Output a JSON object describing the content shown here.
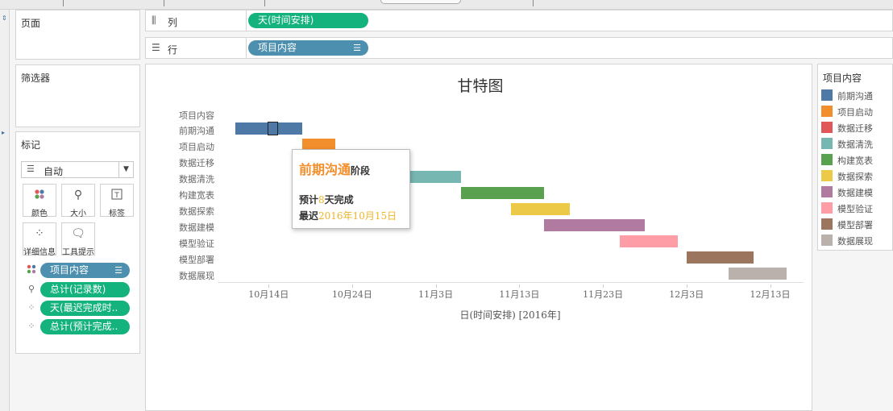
{
  "panels": {
    "pages_title": "页面",
    "filters_title": "筛选器",
    "marks_title": "标记"
  },
  "shelves": {
    "columns": {
      "label": "列",
      "pill": "天(时间安排)"
    },
    "rows": {
      "label": "行",
      "pill": "项目内容"
    }
  },
  "marks": {
    "mark_type": "自动",
    "buttons": [
      "颜色",
      "大小",
      "标签",
      "详细信息",
      "工具提示"
    ],
    "fields": [
      {
        "text": "项目内容",
        "color": "blue",
        "icon": "color-dots-icon"
      },
      {
        "text": "总计(记录数)",
        "color": "green",
        "icon": "size-icon"
      },
      {
        "text": "天(最迟完成时..",
        "color": "green",
        "icon": "detail-icon"
      },
      {
        "text": "总计(预计完成..",
        "color": "green",
        "icon": "detail-icon"
      }
    ]
  },
  "chart_data": {
    "type": "bar",
    "title": "甘特图",
    "ylabel_header": "项目内容",
    "categories": [
      "前期沟通",
      "项目启动",
      "数据迁移",
      "数据清洗",
      "构建宽表",
      "数据探索",
      "数据建模",
      "模型验证",
      "模型部署",
      "数据展现"
    ],
    "start": [
      "2016-10-10",
      "2016-10-18",
      "2016-10-22",
      "2016-10-26",
      "2016-11-06",
      "2016-11-12",
      "2016-11-16",
      "2016-11-25",
      "2016-12-03",
      "2016-12-08"
    ],
    "end": [
      "2016-10-18",
      "2016-10-22",
      "2016-10-26",
      "2016-11-06",
      "2016-11-16",
      "2016-11-19",
      "2016-11-28",
      "2016-12-02",
      "2016-12-11",
      "2016-12-15"
    ],
    "colors": [
      "#4e79a7",
      "#f28e2b",
      "#e15759",
      "#76b7b2",
      "#59a14f",
      "#edc948",
      "#b07aa1",
      "#ff9da7",
      "#9c755f",
      "#bab0ac"
    ],
    "x_ticks": [
      "10月14日",
      "10月24日",
      "11月3日",
      "11月13日",
      "11月23日",
      "12月3日",
      "12月13日"
    ],
    "xlim": [
      "2016-10-08",
      "2016-12-17"
    ],
    "xlabel_main": "日(时间安排)",
    "xlabel_suffix": "[2016年]",
    "grid": false,
    "legend_position": "right"
  },
  "tooltip": {
    "name": "前期沟通",
    "stage_word": "阶段",
    "line2_prefix": "预计",
    "line2_value": "8",
    "line2_suffix": "天完成",
    "line3_prefix": "最迟",
    "line3_value": "2016年10月15日"
  },
  "legend": {
    "title": "项目内容"
  }
}
